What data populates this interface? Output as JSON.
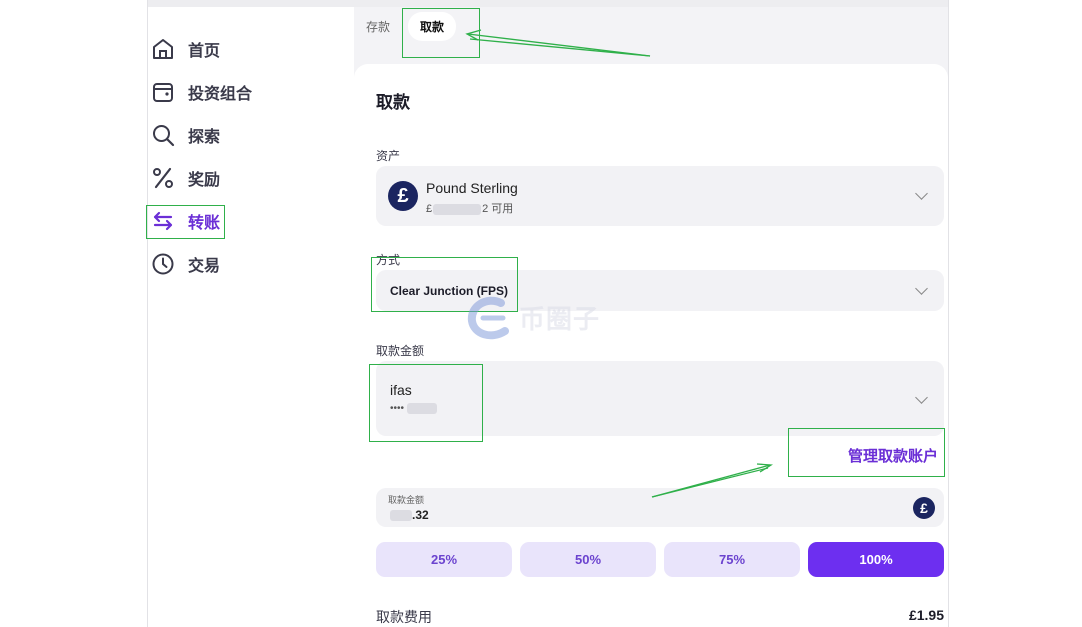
{
  "sidebar": {
    "items": [
      {
        "label": "首页",
        "icon": "home-icon"
      },
      {
        "label": "投资组合",
        "icon": "wallet-icon"
      },
      {
        "label": "探索",
        "icon": "search-icon"
      },
      {
        "label": "奖励",
        "icon": "percent-icon"
      },
      {
        "label": "转账",
        "icon": "transfer-arrows-icon",
        "active": true
      },
      {
        "label": "交易",
        "icon": "clock-icon"
      }
    ]
  },
  "tabs": {
    "deposit": "存款",
    "withdraw": "取款"
  },
  "card": {
    "title": "取款",
    "asset": {
      "label": "资产",
      "name": "Pound Sterling",
      "balance_prefix": "£",
      "balance_suffix": "2 可用",
      "icon": "pound-coin-icon"
    },
    "method": {
      "label": "方式",
      "value": "Clear Junction (FPS)"
    },
    "account": {
      "label": "取款金额",
      "name": "ifas",
      "number_prefix": "•••• "
    },
    "manage_link": "管理取款账户",
    "amount": {
      "label": "取款金额",
      "value_suffix": ".32",
      "currency_symbol": "£"
    },
    "percent_buttons": [
      "25%",
      "50%",
      "75%",
      "100%"
    ],
    "fee": {
      "label": "取款费用",
      "value": "£1.95"
    }
  },
  "watermark": "币圈子",
  "colors": {
    "accent": "#6d2ff0",
    "annotation": "#2fb04a",
    "coin": "#1b2560"
  }
}
